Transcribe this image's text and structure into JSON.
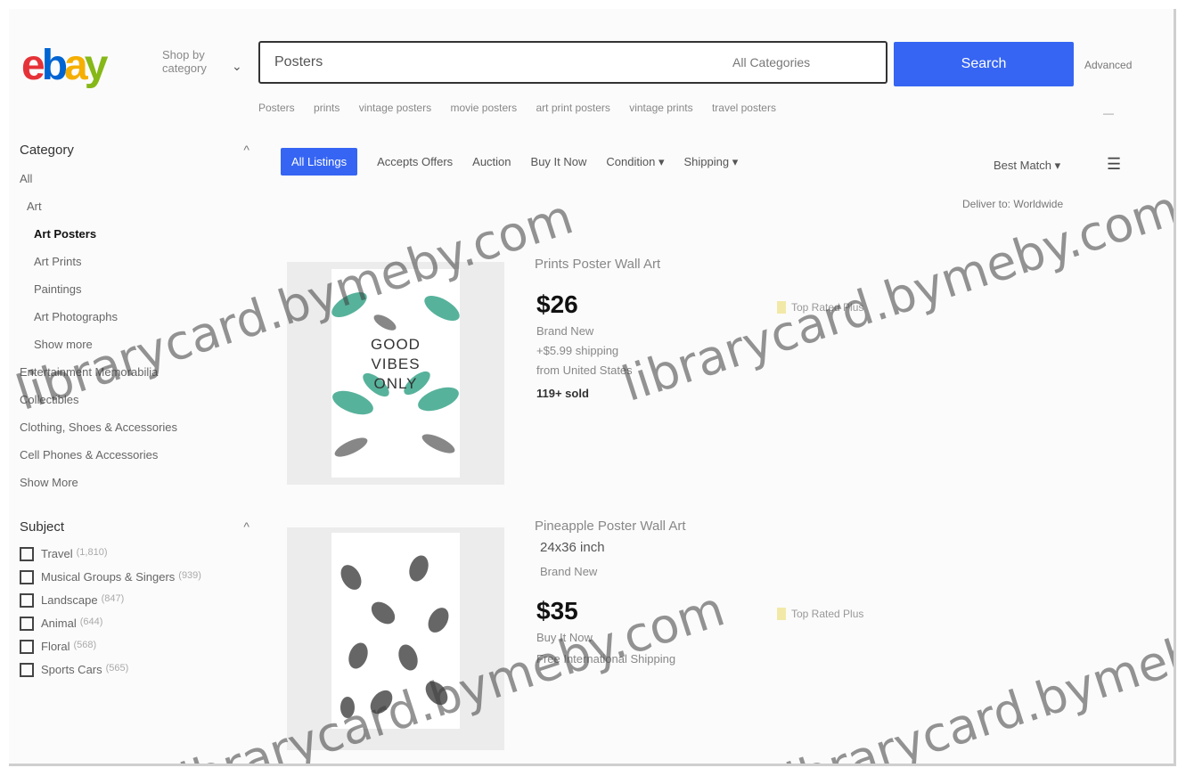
{
  "header": {
    "logo": {
      "e": "e",
      "b": "b",
      "a": "a",
      "y": "y"
    },
    "shop_by_category": "Shop by category",
    "search_value": "Posters",
    "search_category": "All Categories",
    "search_button": "Search",
    "advanced": "Advanced"
  },
  "related": [
    "Posters",
    "prints",
    "vintage posters",
    "movie posters",
    "art print posters",
    "vintage prints",
    "travel posters"
  ],
  "sidebar": {
    "category_heading": "Category",
    "categories": [
      {
        "label": "All",
        "active": false
      },
      {
        "label": "Art",
        "active": false
      },
      {
        "label": "Art Posters",
        "active": true
      },
      {
        "label": "Art Prints",
        "active": false
      },
      {
        "label": "Paintings",
        "active": false
      },
      {
        "label": "Art Photographs",
        "active": false
      },
      {
        "label": "Show more",
        "active": false
      },
      {
        "label": "Entertainment Memorabilia",
        "active": false
      },
      {
        "label": "Collectibles",
        "active": false
      },
      {
        "label": "Clothing, Shoes & Accessories",
        "active": false
      },
      {
        "label": "Cell Phones & Accessories",
        "active": false
      },
      {
        "label": "Show More",
        "active": false
      }
    ],
    "subject_heading": "Subject",
    "subjects": [
      {
        "label": "Travel",
        "count": "(1,810)"
      },
      {
        "label": "Musical Groups & Singers",
        "count": "(939)"
      },
      {
        "label": "Landscape",
        "count": "(847)"
      },
      {
        "label": "Animal",
        "count": "(644)"
      },
      {
        "label": "Floral",
        "count": "(568)"
      },
      {
        "label": "Sports Cars",
        "count": "(565)"
      }
    ]
  },
  "filters": {
    "all_listings": "All Listings",
    "accepts_offers": "Accepts Offers",
    "auction": "Auction",
    "buy_it_now": "Buy It Now",
    "condition": "Condition",
    "shipping": "Shipping",
    "sort": "Best Match",
    "deliver_to": "Deliver to: Worldwide"
  },
  "items": [
    {
      "title": "Prints Poster Wall Art",
      "price": "$26",
      "condition": "Brand New",
      "shipping": "+$5.99 shipping",
      "location": "from United States",
      "sold": "119+ sold",
      "promo": "Top Rated Plus",
      "poster_text": [
        "GOOD",
        "VIBES",
        "ONLY"
      ]
    },
    {
      "title": "Pineapple Poster Wall Art",
      "subtitle": "24x36 inch",
      "subtitle2": "Brand New",
      "price": "$35",
      "condition": "Buy It Now",
      "shipping": "Free International Shipping",
      "promo": "Top Rated Plus"
    }
  ],
  "watermark": "librarycard.bymeby.com",
  "colors": {
    "accent": "#3665f3",
    "logo_red": "#e53238",
    "logo_blue": "#0064d2",
    "logo_yellow": "#f5af02",
    "logo_green": "#86b817"
  },
  "icons": [
    "chevron-down-icon",
    "chevron-up-icon",
    "list-view-icon",
    "tag-icon"
  ]
}
